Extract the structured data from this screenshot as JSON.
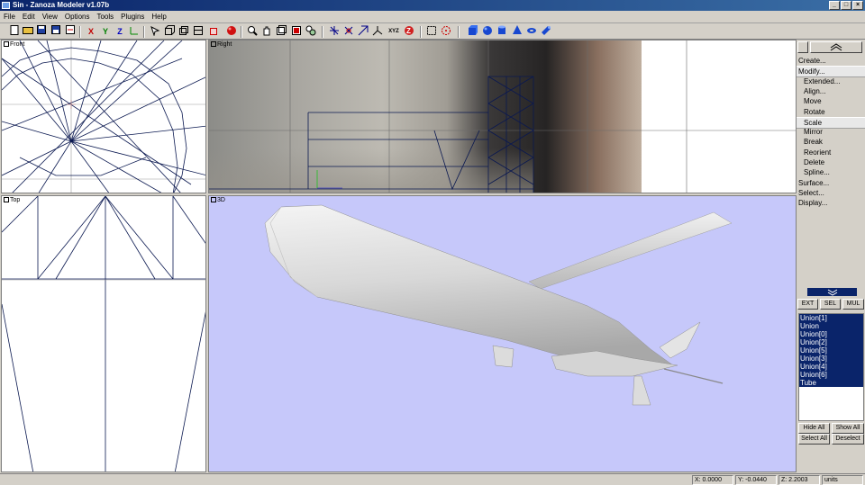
{
  "window": {
    "title": "Sin - Zanoza Modeler v1.07b",
    "min": "_",
    "max": "□",
    "close": "×"
  },
  "menu": [
    "File",
    "Edit",
    "View",
    "Options",
    "Tools",
    "Plugins",
    "Help"
  ],
  "toolbar": {
    "x": "X",
    "y": "Y",
    "z": "Z",
    "xyz": "XYZ"
  },
  "viewports": {
    "front": "Front",
    "right": "Right",
    "top": "Top",
    "persp": "3D"
  },
  "panel": {
    "commands": [
      {
        "label": "Create...",
        "sub": false
      },
      {
        "label": "Modify...",
        "sub": false,
        "sel": true
      },
      {
        "label": "Extended...",
        "sub": true
      },
      {
        "label": "Align...",
        "sub": true
      },
      {
        "label": "Move",
        "sub": true
      },
      {
        "label": "Rotate",
        "sub": true
      },
      {
        "label": "Scale",
        "sub": true,
        "sel": true
      },
      {
        "label": "Mirror",
        "sub": true
      },
      {
        "label": "Break",
        "sub": true
      },
      {
        "label": "Reorient",
        "sub": true
      },
      {
        "label": "Delete",
        "sub": true
      },
      {
        "label": "Spline...",
        "sub": true
      },
      {
        "label": "Surface...",
        "sub": false
      },
      {
        "label": "Select...",
        "sub": false
      },
      {
        "label": "Display...",
        "sub": false
      }
    ],
    "mode_buttons": {
      "ext": "EXT",
      "sel": "SEL",
      "mul": "MUL"
    },
    "objects": [
      "Union[1]",
      "Union",
      "Union[0]",
      "Union[2]",
      "Union[5]",
      "Union[3]",
      "Union[4]",
      "Union[6]",
      "Tube"
    ],
    "hide_all": "Hide All",
    "show_all": "Show All",
    "select_all": "Select All",
    "deselect": "Deselect"
  },
  "status": {
    "x": "X: 0.0000",
    "y": "Y: -0.0440",
    "z": "Z: 2.2003",
    "units": "units"
  }
}
